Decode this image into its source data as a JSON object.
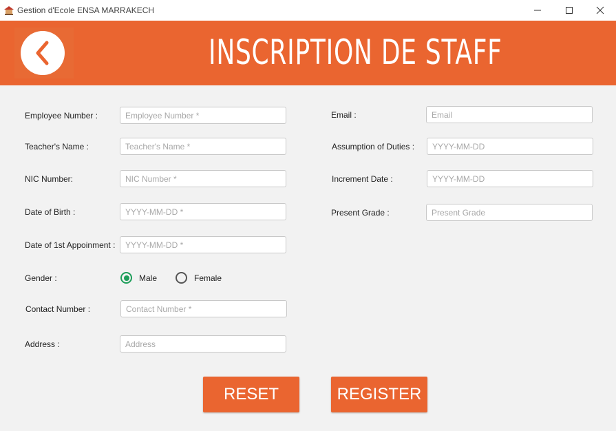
{
  "window": {
    "title": "Gestion d'Ecole ENSA MARRAKECH"
  },
  "header": {
    "title": "INSCRIPTION DE STAFF",
    "back_icon": "chevron-left-icon"
  },
  "colors": {
    "accent": "#ea6530",
    "radio_selected": "#1e9e5a"
  },
  "form": {
    "left": [
      {
        "key": "employee_number",
        "label": "Employee Number :",
        "placeholder": "Employee Number *"
      },
      {
        "key": "teacher_name",
        "label": "Teacher's Name :",
        "placeholder": "Teacher's Name *"
      },
      {
        "key": "nic_number",
        "label": "NIC Number:",
        "placeholder": "NIC Number *"
      },
      {
        "key": "date_of_birth",
        "label": "Date of Birth :",
        "placeholder": "YYYY-MM-DD *"
      },
      {
        "key": "first_appointment",
        "label": "Date of 1st Appoinment :",
        "placeholder": "YYYY-MM-DD *"
      },
      {
        "key": "contact_number",
        "label": "Contact Number :",
        "placeholder": "Contact Number *"
      },
      {
        "key": "address",
        "label": "Address :",
        "placeholder": "Address"
      }
    ],
    "right": [
      {
        "key": "email",
        "label": "Email :",
        "placeholder": "Email"
      },
      {
        "key": "assumption_of_duties",
        "label": "Assumption of Duties :",
        "placeholder": "YYYY-MM-DD"
      },
      {
        "key": "increment_date",
        "label": "Increment Date :",
        "placeholder": "YYYY-MM-DD"
      },
      {
        "key": "present_grade",
        "label": "Present Grade :",
        "placeholder": "Present Grade"
      }
    ],
    "gender": {
      "label": "Gender :",
      "options": [
        {
          "label": "Male",
          "selected": true
        },
        {
          "label": "Female",
          "selected": false
        }
      ]
    }
  },
  "buttons": {
    "reset": "RESET",
    "register": "REGISTER"
  }
}
